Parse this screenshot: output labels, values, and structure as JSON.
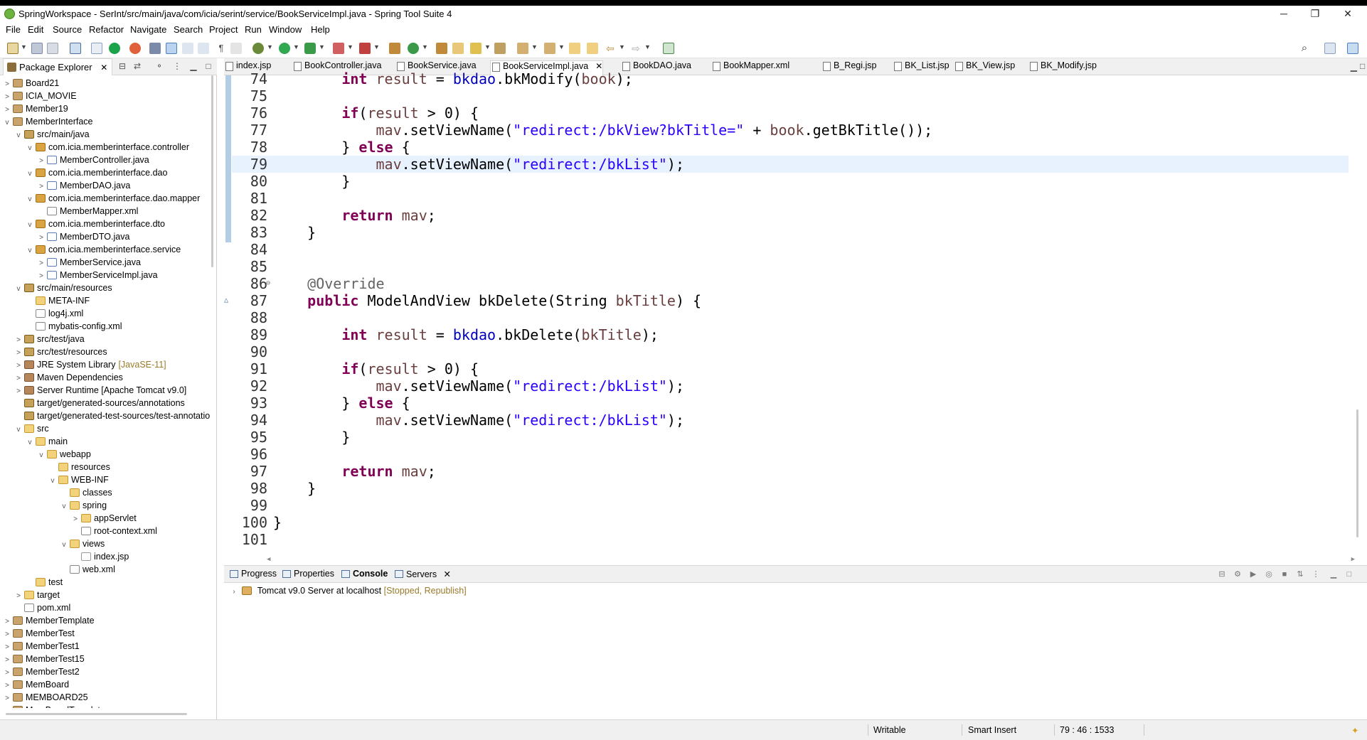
{
  "window": {
    "title": "SpringWorkspace - SerInt/src/main/java/com/icia/serint/service/BookServiceImpl.java - Spring Tool Suite 4",
    "controls": {
      "minimize": "─",
      "restore": "❐",
      "close": "✕"
    }
  },
  "menu": [
    "File",
    "Edit",
    "Source",
    "Refactor",
    "Navigate",
    "Search",
    "Project",
    "Run",
    "Window",
    "Help"
  ],
  "package_explorer": {
    "tab_label": "Package Explorer",
    "tree": [
      {
        "label": "Board21",
        "type": "project",
        "twisty": ">"
      },
      {
        "label": "ICIA_MOVIE",
        "type": "project",
        "twisty": ">"
      },
      {
        "label": "Member19",
        "type": "project",
        "twisty": ">"
      },
      {
        "label": "MemberInterface",
        "type": "project",
        "twisty": "v"
      },
      {
        "label": "src/main/java",
        "type": "srcf",
        "twisty": "v"
      },
      {
        "label": "com.icia.memberinterface.controller",
        "type": "pkg",
        "twisty": "v"
      },
      {
        "label": "MemberController.java",
        "type": "java",
        "twisty": ">"
      },
      {
        "label": "com.icia.memberinterface.dao",
        "type": "pkg",
        "twisty": "v"
      },
      {
        "label": "MemberDAO.java",
        "type": "java",
        "twisty": ">"
      },
      {
        "label": "com.icia.memberinterface.dao.mapper",
        "type": "pkg",
        "twisty": "v"
      },
      {
        "label": "MemberMapper.xml",
        "type": "xml",
        "twisty": ""
      },
      {
        "label": "com.icia.memberinterface.dto",
        "type": "pkg",
        "twisty": "v"
      },
      {
        "label": "MemberDTO.java",
        "type": "java",
        "twisty": ">"
      },
      {
        "label": "com.icia.memberinterface.service",
        "type": "pkg",
        "twisty": "v"
      },
      {
        "label": "MemberService.java",
        "type": "java",
        "twisty": ">"
      },
      {
        "label": "MemberServiceImpl.java",
        "type": "java",
        "twisty": ">"
      },
      {
        "label": "src/main/resources",
        "type": "srcf",
        "twisty": "v"
      },
      {
        "label": "META-INF",
        "type": "folder",
        "twisty": ""
      },
      {
        "label": "log4j.xml",
        "type": "xml",
        "twisty": ""
      },
      {
        "label": "mybatis-config.xml",
        "type": "xml",
        "twisty": ""
      },
      {
        "label": "src/test/java",
        "type": "srcf",
        "twisty": ">"
      },
      {
        "label": "src/test/resources",
        "type": "srcf",
        "twisty": ">"
      },
      {
        "label": "JRE System Library",
        "type": "lib",
        "twisty": ">",
        "decoration": "[JavaSE-11]"
      },
      {
        "label": "Maven Dependencies",
        "type": "lib",
        "twisty": ">"
      },
      {
        "label": "Server Runtime [Apache Tomcat v9.0]",
        "type": "lib",
        "twisty": ">"
      },
      {
        "label": "target/generated-sources/annotations",
        "type": "srcf",
        "twisty": ""
      },
      {
        "label": "target/generated-test-sources/test-annotatio",
        "type": "srcf",
        "twisty": ""
      },
      {
        "label": "src",
        "type": "folder",
        "twisty": "v"
      },
      {
        "label": "main",
        "type": "folder",
        "twisty": "v"
      },
      {
        "label": "webapp",
        "type": "folder",
        "twisty": "v"
      },
      {
        "label": "resources",
        "type": "folder",
        "twisty": ""
      },
      {
        "label": "WEB-INF",
        "type": "folder",
        "twisty": "v"
      },
      {
        "label": "classes",
        "type": "folder",
        "twisty": ""
      },
      {
        "label": "spring",
        "type": "folder",
        "twisty": "v"
      },
      {
        "label": "appServlet",
        "type": "folder",
        "twisty": ">"
      },
      {
        "label": "root-context.xml",
        "type": "xml",
        "twisty": ""
      },
      {
        "label": "views",
        "type": "folder",
        "twisty": "v"
      },
      {
        "label": "index.jsp",
        "type": "jsp",
        "twisty": ""
      },
      {
        "label": "web.xml",
        "type": "xml",
        "twisty": ""
      },
      {
        "label": "test",
        "type": "folder",
        "twisty": ""
      },
      {
        "label": "target",
        "type": "folder",
        "twisty": ">"
      },
      {
        "label": "pom.xml",
        "type": "xml",
        "twisty": ""
      },
      {
        "label": "MemberTemplate",
        "type": "project",
        "twisty": ">"
      },
      {
        "label": "MemberTest",
        "type": "project",
        "twisty": ">"
      },
      {
        "label": "MemberTest1",
        "type": "project",
        "twisty": ">"
      },
      {
        "label": "MemberTest15",
        "type": "project",
        "twisty": ">"
      },
      {
        "label": "MemberTest2",
        "type": "project",
        "twisty": ">"
      },
      {
        "label": "MemBoard",
        "type": "project",
        "twisty": ">"
      },
      {
        "label": "MEMBOARD25",
        "type": "project",
        "twisty": ">"
      },
      {
        "label": "MemBoardTemplate",
        "type": "project",
        "twisty": ">"
      }
    ]
  },
  "editor_tabs": [
    {
      "label": "index.jsp",
      "active": false
    },
    {
      "label": "BookController.java",
      "active": false
    },
    {
      "label": "BookService.java",
      "active": false
    },
    {
      "label": "BookServiceImpl.java",
      "active": true
    },
    {
      "label": "BookDAO.java",
      "active": false
    },
    {
      "label": "BookMapper.xml",
      "active": false
    },
    {
      "label": "B_Regi.jsp",
      "active": false
    },
    {
      "label": "BK_List.jsp",
      "active": false
    },
    {
      "label": "BK_View.jsp",
      "active": false
    },
    {
      "label": "BK_Modify.jsp",
      "active": false
    }
  ],
  "code_lines": [
    {
      "num": "74",
      "tokens": [
        [
          "",
          "        "
        ],
        [
          "kw",
          "int"
        ],
        [
          "",
          " "
        ],
        [
          "var",
          "result"
        ],
        [
          "",
          " = "
        ],
        [
          "fld",
          "bkdao"
        ],
        [
          "",
          ".bkModify("
        ],
        [
          "var",
          "book"
        ],
        [
          "",
          ");"
        ]
      ]
    },
    {
      "num": "75",
      "tokens": []
    },
    {
      "num": "76",
      "tokens": [
        [
          "",
          "        "
        ],
        [
          "kw",
          "if"
        ],
        [
          "",
          "("
        ],
        [
          "var",
          "result"
        ],
        [
          "",
          " > 0) {"
        ]
      ]
    },
    {
      "num": "77",
      "tokens": [
        [
          "",
          "            "
        ],
        [
          "var",
          "mav"
        ],
        [
          "",
          ".setViewName("
        ],
        [
          "str",
          "\"redirect:/bkView?bkTitle=\""
        ],
        [
          "",
          " + "
        ],
        [
          "var",
          "book"
        ],
        [
          "",
          ".getBkTitle());"
        ]
      ]
    },
    {
      "num": "78",
      "tokens": [
        [
          "",
          "        } "
        ],
        [
          "kw",
          "else"
        ],
        [
          "",
          " {"
        ]
      ]
    },
    {
      "num": "79",
      "tokens": [
        [
          "",
          "            "
        ],
        [
          "var",
          "mav"
        ],
        [
          "",
          ".setViewName("
        ],
        [
          "str",
          "\"redirect:/bkList\""
        ],
        [
          "",
          ");"
        ]
      ],
      "current": true
    },
    {
      "num": "80",
      "tokens": [
        [
          "",
          "        }"
        ]
      ]
    },
    {
      "num": "81",
      "tokens": []
    },
    {
      "num": "82",
      "tokens": [
        [
          "",
          "        "
        ],
        [
          "kw",
          "return"
        ],
        [
          "",
          " "
        ],
        [
          "var",
          "mav"
        ],
        [
          "",
          ";"
        ]
      ]
    },
    {
      "num": "83",
      "tokens": [
        [
          "",
          "    }"
        ]
      ]
    },
    {
      "num": "84",
      "tokens": []
    },
    {
      "num": "85",
      "tokens": []
    },
    {
      "num": "86",
      "tokens": [
        [
          "",
          "    "
        ],
        [
          "ann",
          "@Override"
        ]
      ],
      "fold": "⊖"
    },
    {
      "num": "87",
      "tokens": [
        [
          "",
          "    "
        ],
        [
          "kw",
          "public"
        ],
        [
          "",
          " ModelAndView bkDelete(String "
        ],
        [
          "var",
          "bkTitle"
        ],
        [
          "",
          ") {"
        ]
      ],
      "marker": "△"
    },
    {
      "num": "88",
      "tokens": []
    },
    {
      "num": "89",
      "tokens": [
        [
          "",
          "        "
        ],
        [
          "kw",
          "int"
        ],
        [
          "",
          " "
        ],
        [
          "var",
          "result"
        ],
        [
          "",
          " = "
        ],
        [
          "fld",
          "bkdao"
        ],
        [
          "",
          ".bkDelete("
        ],
        [
          "var",
          "bkTitle"
        ],
        [
          "",
          ");"
        ]
      ]
    },
    {
      "num": "90",
      "tokens": []
    },
    {
      "num": "91",
      "tokens": [
        [
          "",
          "        "
        ],
        [
          "kw",
          "if"
        ],
        [
          "",
          "("
        ],
        [
          "var",
          "result"
        ],
        [
          "",
          " > 0) {"
        ]
      ]
    },
    {
      "num": "92",
      "tokens": [
        [
          "",
          "            "
        ],
        [
          "var",
          "mav"
        ],
        [
          "",
          ".setViewName("
        ],
        [
          "str",
          "\"redirect:/bkList\""
        ],
        [
          "",
          ");"
        ]
      ]
    },
    {
      "num": "93",
      "tokens": [
        [
          "",
          "        } "
        ],
        [
          "kw",
          "else"
        ],
        [
          "",
          " {"
        ]
      ]
    },
    {
      "num": "94",
      "tokens": [
        [
          "",
          "            "
        ],
        [
          "var",
          "mav"
        ],
        [
          "",
          ".setViewName("
        ],
        [
          "str",
          "\"redirect:/bkList\""
        ],
        [
          "",
          ");"
        ]
      ]
    },
    {
      "num": "95",
      "tokens": [
        [
          "",
          "        }"
        ]
      ]
    },
    {
      "num": "96",
      "tokens": []
    },
    {
      "num": "97",
      "tokens": [
        [
          "",
          "        "
        ],
        [
          "kw",
          "return"
        ],
        [
          "",
          " "
        ],
        [
          "var",
          "mav"
        ],
        [
          "",
          ";"
        ]
      ]
    },
    {
      "num": "98",
      "tokens": [
        [
          "",
          "    }"
        ]
      ]
    },
    {
      "num": "99",
      "tokens": []
    },
    {
      "num": "100",
      "tokens": [
        [
          "",
          "}"
        ]
      ]
    },
    {
      "num": "101",
      "tokens": []
    }
  ],
  "bottom_panel": {
    "tabs": [
      {
        "label": "Progress",
        "active": false
      },
      {
        "label": "Properties",
        "active": false
      },
      {
        "label": "Console",
        "active": true
      },
      {
        "label": "Servers",
        "active": false,
        "closable": true
      }
    ],
    "server": {
      "name": "Tomcat v9.0 Server at localhost",
      "status": "[Stopped, Republish]"
    }
  },
  "status_bar": {
    "writable": "Writable",
    "insert_mode": "Smart Insert",
    "position": "79 : 46 : 1533"
  },
  "colors": {
    "keyword": "#7f0055",
    "string": "#2a00ff",
    "field": "#0000c0",
    "variable": "#6a3e3e",
    "annotation": "#646464",
    "current_line": "#e8f2fe"
  }
}
